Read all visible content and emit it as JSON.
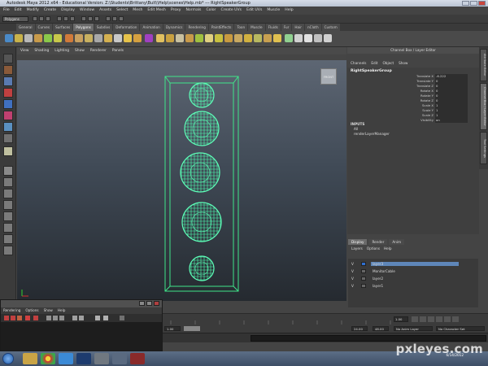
{
  "window": {
    "title": "Autodesk Maya 2012 x64 - Educational Version: Z:\\Students\\Brittany\\Bult\\\\Help\\scenes\\Help.mb* --- RightSpeakerGroup"
  },
  "menubar": [
    "File",
    "Edit",
    "Modify",
    "Create",
    "Display",
    "Window",
    "Assets",
    "Select",
    "Mesh",
    "Edit Mesh",
    "Proxy",
    "Normals",
    "Color",
    "Create UVs",
    "Edit UVs",
    "Muscle",
    "Help"
  ],
  "status_line": {
    "mode": "Polygons"
  },
  "shelf_tabs": [
    "General",
    "Curves",
    "Surfaces",
    "Polygons",
    "Subdivs",
    "Deformation",
    "Animation",
    "Dynamics",
    "Rendering",
    "PaintEffects",
    "Toon",
    "Muscle",
    "Fluids",
    "Fur",
    "Hair",
    "nCloth",
    "Custom"
  ],
  "active_shelf": "Polygons",
  "panel_menu": [
    "View",
    "Shading",
    "Lighting",
    "Show",
    "Renderer",
    "Panels"
  ],
  "viewport": {
    "camera_label": "FRONT",
    "speakers": 5
  },
  "channel_box": {
    "title": "Channel Box / Layer Editor",
    "menu": [
      "Channels",
      "Edit",
      "Object",
      "Show"
    ],
    "object_name": "RightSpeakerGroup",
    "attributes": [
      {
        "name": "Translate X",
        "value": "-6.222"
      },
      {
        "name": "Translate Y",
        "value": "0"
      },
      {
        "name": "Translate Z",
        "value": "0"
      },
      {
        "name": "Rotate X",
        "value": "0"
      },
      {
        "name": "Rotate Y",
        "value": "0"
      },
      {
        "name": "Rotate Z",
        "value": "0"
      },
      {
        "name": "Scale X",
        "value": "1"
      },
      {
        "name": "Scale Y",
        "value": "1"
      },
      {
        "name": "Scale Z",
        "value": "1"
      },
      {
        "name": "Visibility",
        "value": "on"
      }
    ],
    "inputs_label": "INPUTS",
    "inputs": [
      "All",
      "renderLayerManager"
    ]
  },
  "side_tabs": [
    "Attribute Editor",
    "Channel Box / Layer Editor",
    "Tool Settings"
  ],
  "layer_editor": {
    "tabs": [
      "Display",
      "Render",
      "Anim"
    ],
    "active_tab": "Display",
    "menu": [
      "Layers",
      "Options",
      "Help"
    ],
    "layers": [
      {
        "v": "V",
        "name": "layer3",
        "selected": true,
        "color": "#2f6fd0"
      },
      {
        "v": "V",
        "name": "MonitorCable",
        "selected": false,
        "color": "#6a6a6a"
      },
      {
        "v": "V",
        "name": "layer2",
        "selected": false,
        "color": "#6a6a6a"
      },
      {
        "v": "V",
        "name": "layer1",
        "selected": false,
        "color": "#6a6a6a"
      }
    ]
  },
  "time": {
    "current_frame": "1.00",
    "range_start": "1.00",
    "range_end": "24.00",
    "playback_end": "48.00",
    "anim_layer": "No Anim Layer",
    "character_set": "No Character Set"
  },
  "floating_window": {
    "menu": [
      "Rendering",
      "Options",
      "Show",
      "Help"
    ]
  },
  "taskbar": {
    "time": "",
    "date": "6/14/2012"
  },
  "watermark": "pxleyes.com"
}
